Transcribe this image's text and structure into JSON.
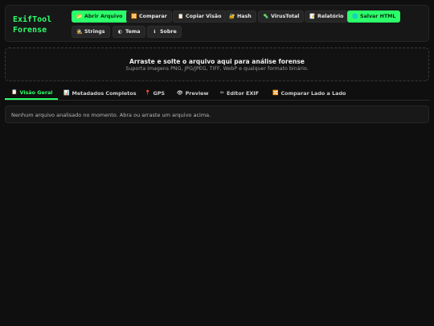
{
  "app": {
    "title_line1": "ExifTool",
    "title_line2": "Forense"
  },
  "toolbar": {
    "buttons": [
      {
        "icon": "📂",
        "label": "Abrir Arquivo"
      },
      {
        "icon": "🔀",
        "label": "Comparar"
      },
      {
        "icon": "📋",
        "label": "Copiar Visão"
      },
      {
        "icon": "🔐",
        "label": "Hash"
      },
      {
        "icon": "🦠",
        "label": "VirusTotal"
      },
      {
        "icon": "📝",
        "label": "Relatório"
      },
      {
        "icon": "🌐",
        "label": "Salvar HTML"
      },
      {
        "icon": "🕵",
        "label": "Strings"
      },
      {
        "icon": "◐",
        "label": "Tema"
      },
      {
        "icon": "ℹ",
        "label": "Sobre"
      }
    ]
  },
  "dropzone": {
    "title": "Arraste e solte o arquivo aqui para análise forense",
    "subtitle": "Suporta imagens PNG, JPG/JPEG, TIFF, WebP e qualquer formato binário."
  },
  "tabs": [
    {
      "icon": "📋",
      "label": "Visão Geral"
    },
    {
      "icon": "📊",
      "label": "Metadados Completos"
    },
    {
      "icon": "📍",
      "label": "GPS"
    },
    {
      "icon": "👁",
      "label": "Preview"
    },
    {
      "icon": "✏",
      "label": "Editor EXIF"
    },
    {
      "icon": "🔀",
      "label": "Comparar Lado a Lado"
    }
  ],
  "content": {
    "message": "Nenhum arquivo analisado no momento. Abra ou arraste um arquivo acima."
  },
  "colors": {
    "accent": "#2bff6a",
    "background": "#0f0f0f",
    "panel": "#171717"
  }
}
